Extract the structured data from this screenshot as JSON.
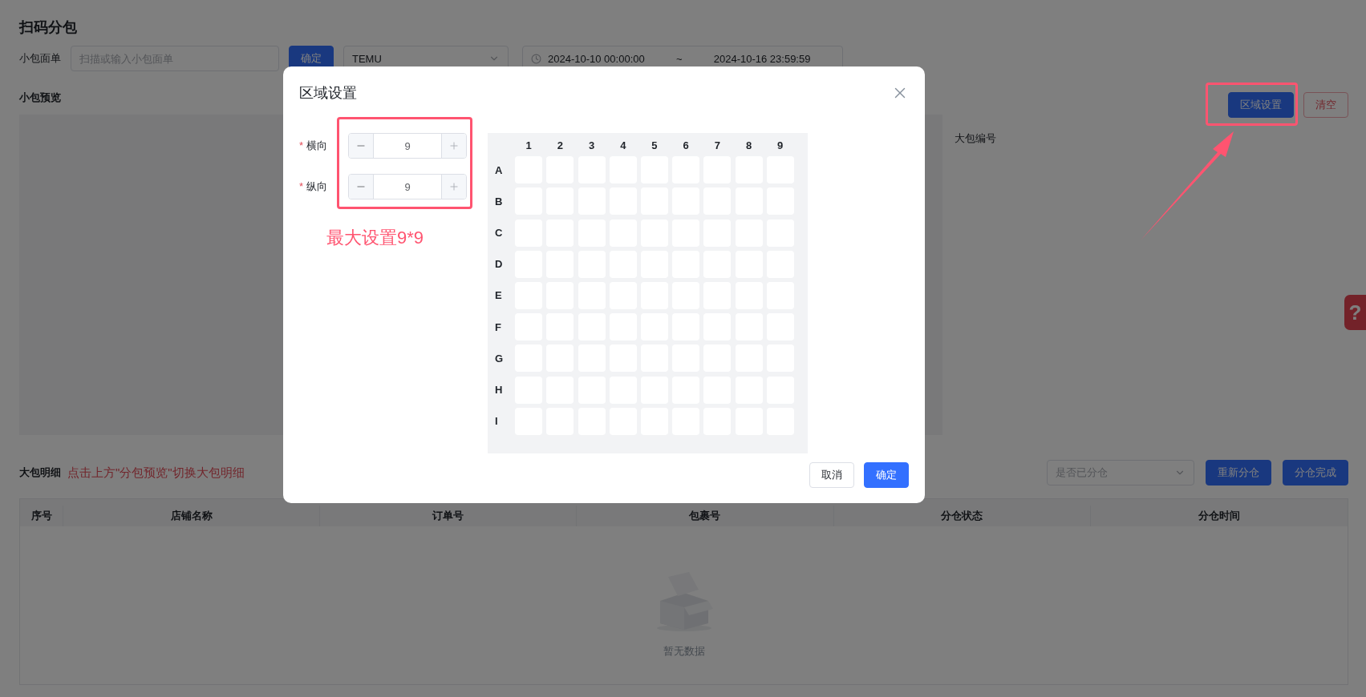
{
  "page": {
    "title": "扫码分包"
  },
  "scan_bar": {
    "label": "小包面单",
    "input": {
      "placeholder": "扫描或输入小包面单"
    },
    "confirm_button": "确定",
    "platform_select": {
      "value": "TEMU"
    },
    "date_range": {
      "start": "2024-10-10 00:00:00",
      "separator": "~",
      "end": "2024-10-16 23:59:59"
    }
  },
  "preview": {
    "title": "小包预览",
    "buttons": [
      {
        "label": "区域设置",
        "kind": "primary"
      },
      {
        "label": "清空",
        "kind": "danger"
      }
    ],
    "big_package_label": "大包编号"
  },
  "details": {
    "title": "大包明细",
    "hint": "点击上方\"分包预览\"切换大包明细",
    "filter_select": {
      "placeholder": "是否已分仓"
    },
    "buttons": [
      "重新分仓",
      "分仓完成"
    ],
    "table": {
      "columns": [
        "序号",
        "店铺名称",
        "订单号",
        "包裹号",
        "分仓状态",
        "分仓时间"
      ],
      "empty_text": "暂无数据"
    }
  },
  "help_button": "?",
  "dialog": {
    "title": "区域设置",
    "fields": [
      {
        "marker": "*",
        "label": "横向",
        "value": "9"
      },
      {
        "marker": "*",
        "label": "纵向",
        "value": "9"
      }
    ],
    "grid": {
      "columns": [
        "1",
        "2",
        "3",
        "4",
        "5",
        "6",
        "7",
        "8",
        "9"
      ],
      "rows": [
        "A",
        "B",
        "C",
        "D",
        "E",
        "F",
        "G",
        "H",
        "I"
      ]
    },
    "buttons": [
      {
        "label": "取消",
        "kind": "default"
      },
      {
        "label": "确定",
        "kind": "primary"
      }
    ]
  },
  "annotation": {
    "note": "最大设置9*9"
  }
}
